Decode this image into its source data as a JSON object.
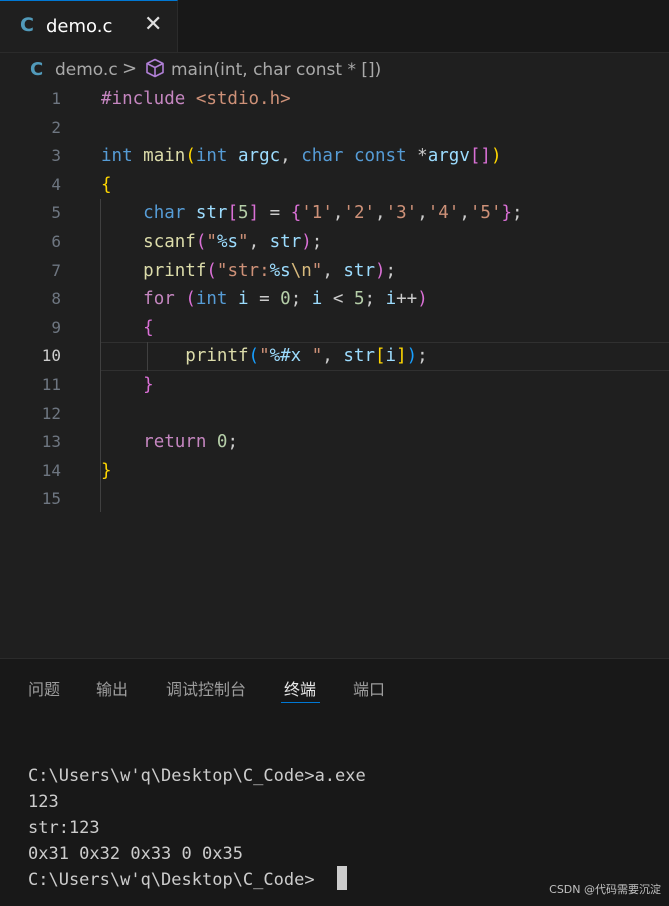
{
  "tab": {
    "icon": "C",
    "title": "demo.c",
    "close": "✕"
  },
  "breadcrumb": {
    "icon": "C",
    "file": "demo.c",
    "separator": ">",
    "symbol_icon": "cube-icon",
    "symbol": "main(int, char const * [])"
  },
  "editor": {
    "current_line": 10,
    "lines": [
      {
        "n": "1",
        "tokens": [
          {
            "t": "#include ",
            "c": "k-pp"
          },
          {
            "t": "<stdio.h>",
            "c": "k-str"
          }
        ]
      },
      {
        "n": "2",
        "tokens": []
      },
      {
        "n": "3",
        "tokens": [
          {
            "t": "int",
            "c": "k-type"
          },
          {
            "t": " "
          },
          {
            "t": "main",
            "c": "k-fn"
          },
          {
            "t": "(",
            "c": "b1"
          },
          {
            "t": "int",
            "c": "k-type"
          },
          {
            "t": " "
          },
          {
            "t": "argc",
            "c": "k-var"
          },
          {
            "t": ", "
          },
          {
            "t": "char",
            "c": "k-type"
          },
          {
            "t": " "
          },
          {
            "t": "const",
            "c": "k-type"
          },
          {
            "t": " *"
          },
          {
            "t": "argv",
            "c": "k-var"
          },
          {
            "t": "[]",
            "c": "b2"
          },
          {
            "t": ")",
            "c": "b1"
          }
        ]
      },
      {
        "n": "4",
        "tokens": [
          {
            "t": "{",
            "c": "b1"
          }
        ]
      },
      {
        "n": "5",
        "tokens": [
          {
            "t": "    "
          },
          {
            "t": "char",
            "c": "k-type"
          },
          {
            "t": " "
          },
          {
            "t": "str",
            "c": "k-var"
          },
          {
            "t": "[",
            "c": "b2"
          },
          {
            "t": "5",
            "c": "k-num"
          },
          {
            "t": "]",
            "c": "b2"
          },
          {
            "t": " = "
          },
          {
            "t": "{",
            "c": "b2"
          },
          {
            "t": "'1'",
            "c": "k-str"
          },
          {
            "t": ","
          },
          {
            "t": "'2'",
            "c": "k-str"
          },
          {
            "t": ","
          },
          {
            "t": "'3'",
            "c": "k-str"
          },
          {
            "t": ","
          },
          {
            "t": "'4'",
            "c": "k-str"
          },
          {
            "t": ","
          },
          {
            "t": "'5'",
            "c": "k-str"
          },
          {
            "t": "}",
            "c": "b2"
          },
          {
            "t": ";"
          }
        ]
      },
      {
        "n": "6",
        "tokens": [
          {
            "t": "    "
          },
          {
            "t": "scanf",
            "c": "k-fn"
          },
          {
            "t": "(",
            "c": "b2"
          },
          {
            "t": "\"",
            "c": "k-str"
          },
          {
            "t": "%s",
            "c": "k-var"
          },
          {
            "t": "\"",
            "c": "k-str"
          },
          {
            "t": ", "
          },
          {
            "t": "str",
            "c": "k-var"
          },
          {
            "t": ")",
            "c": "b2"
          },
          {
            "t": ";"
          }
        ]
      },
      {
        "n": "7",
        "tokens": [
          {
            "t": "    "
          },
          {
            "t": "printf",
            "c": "k-fn"
          },
          {
            "t": "(",
            "c": "b2"
          },
          {
            "t": "\"str:",
            "c": "k-str"
          },
          {
            "t": "%s",
            "c": "k-var"
          },
          {
            "t": "\\n",
            "c": "k-esc"
          },
          {
            "t": "\"",
            "c": "k-str"
          },
          {
            "t": ", "
          },
          {
            "t": "str",
            "c": "k-var"
          },
          {
            "t": ")",
            "c": "b2"
          },
          {
            "t": ";"
          }
        ]
      },
      {
        "n": "8",
        "tokens": [
          {
            "t": "    "
          },
          {
            "t": "for",
            "c": "k-ctl"
          },
          {
            "t": " "
          },
          {
            "t": "(",
            "c": "b2"
          },
          {
            "t": "int",
            "c": "k-type"
          },
          {
            "t": " "
          },
          {
            "t": "i",
            "c": "k-var"
          },
          {
            "t": " = "
          },
          {
            "t": "0",
            "c": "k-num"
          },
          {
            "t": "; "
          },
          {
            "t": "i",
            "c": "k-var"
          },
          {
            "t": " < "
          },
          {
            "t": "5",
            "c": "k-num"
          },
          {
            "t": "; "
          },
          {
            "t": "i",
            "c": "k-var"
          },
          {
            "t": "++"
          },
          {
            "t": ")",
            "c": "b2"
          }
        ]
      },
      {
        "n": "9",
        "tokens": [
          {
            "t": "    "
          },
          {
            "t": "{",
            "c": "b2"
          }
        ]
      },
      {
        "n": "10",
        "tokens": [
          {
            "t": "        "
          },
          {
            "t": "printf",
            "c": "k-fn"
          },
          {
            "t": "(",
            "c": "b3"
          },
          {
            "t": "\"",
            "c": "k-str"
          },
          {
            "t": "%#x",
            "c": "k-var"
          },
          {
            "t": " \"",
            "c": "k-str"
          },
          {
            "t": ", "
          },
          {
            "t": "str",
            "c": "k-var"
          },
          {
            "t": "[",
            "c": "b1"
          },
          {
            "t": "i",
            "c": "k-var"
          },
          {
            "t": "]",
            "c": "b1"
          },
          {
            "t": ")",
            "c": "b3"
          },
          {
            "t": ";"
          }
        ]
      },
      {
        "n": "11",
        "tokens": [
          {
            "t": "    "
          },
          {
            "t": "}",
            "c": "b2"
          }
        ]
      },
      {
        "n": "12",
        "tokens": []
      },
      {
        "n": "13",
        "tokens": [
          {
            "t": "    "
          },
          {
            "t": "return",
            "c": "k-ctl"
          },
          {
            "t": " "
          },
          {
            "t": "0",
            "c": "k-num"
          },
          {
            "t": ";"
          }
        ]
      },
      {
        "n": "14",
        "tokens": [
          {
            "t": "}",
            "c": "b1"
          }
        ]
      },
      {
        "n": "15",
        "tokens": []
      }
    ]
  },
  "panel": {
    "tabs": [
      "问题",
      "输出",
      "调试控制台",
      "终端",
      "端口"
    ],
    "active_tab": "终端",
    "terminal_lines": [
      "C:\\Users\\w'q\\Desktop\\C_Code>a.exe",
      "123",
      "str:123",
      "0x31 0x32 0x33 0 0x35",
      "C:\\Users\\w'q\\Desktop\\C_Code>"
    ]
  },
  "watermark": "CSDN @代码需要沉淀",
  "colors": {
    "accent": "#0078d4",
    "editor_bg": "#1f1f1f",
    "panel_bg": "#181818"
  }
}
